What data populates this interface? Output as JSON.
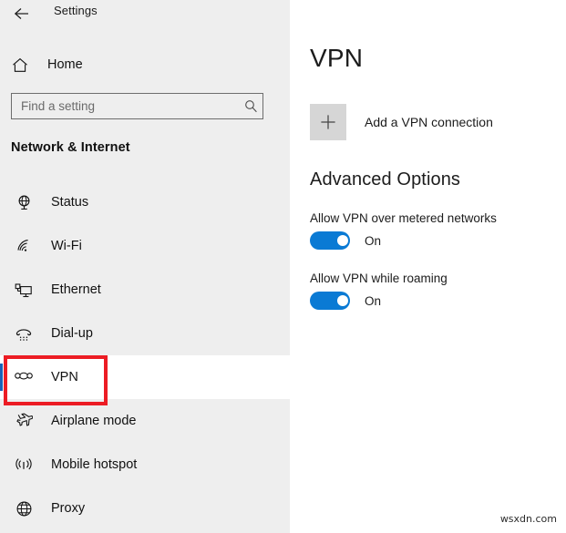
{
  "window": {
    "app_title": "Settings",
    "back_icon": "back-arrow-icon"
  },
  "sidebar": {
    "home": {
      "label": "Home",
      "icon": "home-icon"
    },
    "search": {
      "value": "",
      "placeholder": "Find a setting",
      "icon": "search-icon"
    },
    "section_title": "Network & Internet",
    "items": [
      {
        "label": "Status",
        "icon": "globe-monitor-icon",
        "selected": false
      },
      {
        "label": "Wi-Fi",
        "icon": "wifi-icon",
        "selected": false
      },
      {
        "label": "Ethernet",
        "icon": "ethernet-icon",
        "selected": false
      },
      {
        "label": "Dial-up",
        "icon": "dialup-phone-icon",
        "selected": false
      },
      {
        "label": "VPN",
        "icon": "vpn-icon",
        "selected": true
      },
      {
        "label": "Airplane mode",
        "icon": "airplane-icon",
        "selected": false
      },
      {
        "label": "Mobile hotspot",
        "icon": "broadcast-icon",
        "selected": false
      },
      {
        "label": "Proxy",
        "icon": "globe-icon",
        "selected": false
      }
    ],
    "highlight": {
      "target": "VPN",
      "color": "#ec1c24"
    }
  },
  "content": {
    "page_title": "VPN",
    "add_connection": {
      "label": "Add a VPN connection",
      "icon": "plus-icon"
    },
    "advanced": {
      "title": "Advanced Options",
      "toggles": [
        {
          "label": "Allow VPN over metered networks",
          "state": "On",
          "on": true
        },
        {
          "label": "Allow VPN while roaming",
          "state": "On",
          "on": true
        }
      ]
    }
  },
  "watermark": "wsxdn.com",
  "colors": {
    "accent_blue": "#0a7ad4",
    "selection_blue": "#1a63b8",
    "highlight_red": "#ec1c24",
    "sidebar_bg": "#eeeeee"
  }
}
